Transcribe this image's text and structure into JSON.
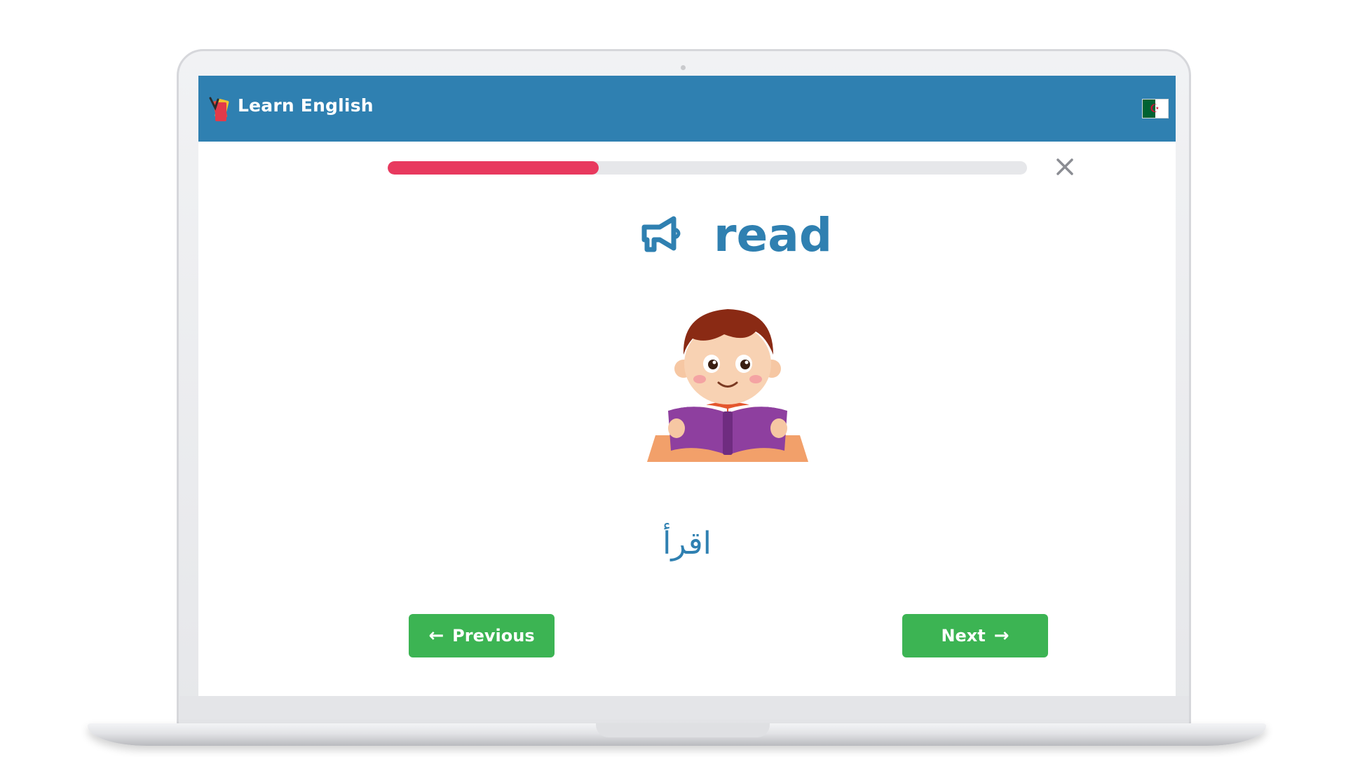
{
  "app": {
    "title": "Learn English",
    "header_color": "#2f80b1",
    "language_flag_icon": "algeria-flag-icon"
  },
  "lesson": {
    "progress_percent": 33,
    "progress_color": "#e8395e",
    "word": "read",
    "translation": "اقرأ",
    "speaker_icon": "megaphone-icon",
    "illustration_icon": "boy-reading-book-illustration"
  },
  "nav": {
    "previous_label": "Previous",
    "next_label": "Next",
    "button_color": "#3cb453"
  }
}
